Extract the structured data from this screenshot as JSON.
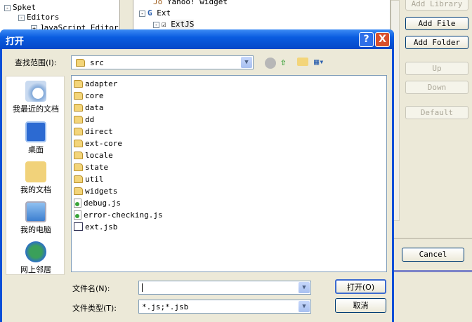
{
  "background": {
    "left_tree": [
      {
        "label": "Spket",
        "expander": "-"
      },
      {
        "label": "Editors",
        "expander": "-"
      },
      {
        "label": "JavaScript Editor",
        "expander": "+"
      }
    ],
    "middle_tree": [
      {
        "label": "Yahoo! widget"
      },
      {
        "label": "Ext",
        "expander": "-"
      },
      {
        "label": "ExtJS",
        "expander": "-"
      }
    ],
    "buttons": {
      "add_library": "Add Library",
      "add_file": "Add File",
      "add_folder": "Add Folder",
      "up": "Up",
      "down": "Down",
      "default": "Default",
      "cancel": "Cancel"
    }
  },
  "dialog": {
    "title": "打开",
    "help": "?",
    "close": "X",
    "look_in_label": "查找范围(I):",
    "look_in_value": "src",
    "places": [
      {
        "label": "我最近的文档",
        "icon": "recent-documents-icon"
      },
      {
        "label": "桌面",
        "icon": "desktop-icon"
      },
      {
        "label": "我的文档",
        "icon": "my-documents-icon"
      },
      {
        "label": "我的电脑",
        "icon": "my-computer-icon"
      },
      {
        "label": "网上邻居",
        "icon": "network-places-icon"
      }
    ],
    "files": [
      {
        "name": "adapter",
        "type": "folder"
      },
      {
        "name": "core",
        "type": "folder"
      },
      {
        "name": "data",
        "type": "folder"
      },
      {
        "name": "dd",
        "type": "folder"
      },
      {
        "name": "direct",
        "type": "folder"
      },
      {
        "name": "ext-core",
        "type": "folder"
      },
      {
        "name": "locale",
        "type": "folder"
      },
      {
        "name": "state",
        "type": "folder"
      },
      {
        "name": "util",
        "type": "folder"
      },
      {
        "name": "widgets",
        "type": "folder"
      },
      {
        "name": "debug.js",
        "type": "js"
      },
      {
        "name": "error-checking.js",
        "type": "js"
      },
      {
        "name": "ext.jsb",
        "type": "jsb"
      }
    ],
    "filename_label": "文件名(N):",
    "filename_value": "",
    "filetype_label": "文件类型(T):",
    "filetype_value": "*.js;*.jsb",
    "open_button": "打开(O)",
    "cancel_button": "取消"
  }
}
